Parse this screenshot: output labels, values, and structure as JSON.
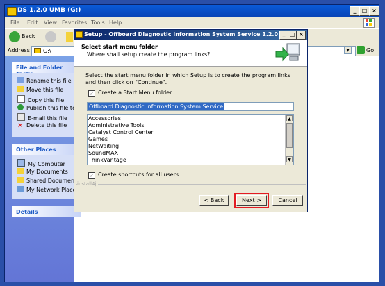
{
  "explorer": {
    "title": "DS 1.2.0 UMB (G:)",
    "menu": [
      "File",
      "Edit",
      "View",
      "Favorites",
      "Tools",
      "Help"
    ],
    "back_label": "Back",
    "address_label": "Address",
    "address_value": "G:\\",
    "go_label": "Go"
  },
  "sidebar": {
    "file_tasks_title": "File and Folder Tasks",
    "file_tasks": [
      "Rename this file",
      "Move this file",
      "Copy this file",
      "Publish this file to the",
      "E-mail this file",
      "Delete this file"
    ],
    "other_places_title": "Other Places",
    "other_places": [
      "My Computer",
      "My Documents",
      "Shared Documents",
      "My Network Places"
    ],
    "details_title": "Details"
  },
  "dialog": {
    "title": "Setup - Offboard Diagnostic Information System Service 1.2.0",
    "heading": "Select start menu folder",
    "subheading": "Where shall setup create the program links?",
    "instruction": "Select the start menu folder in which Setup is to create the program links and then click on \"Continue\".",
    "create_start_menu_label": "Create a Start Menu folder",
    "folder_value": "Offboard Diagnostic Information System Service",
    "folders": [
      "Accessories",
      "Administrative Tools",
      "Catalyst Control Center",
      "Games",
      "NetWaiting",
      "SoundMAX",
      "ThinkVantage"
    ],
    "create_shortcuts_label": "Create shortcuts for all users",
    "brand": "install4j",
    "back_button": "< Back",
    "next_button": "Next >",
    "cancel_button": "Cancel"
  },
  "colors": {
    "desktop": "#2a4fa8",
    "highlight": "#e31b23"
  }
}
